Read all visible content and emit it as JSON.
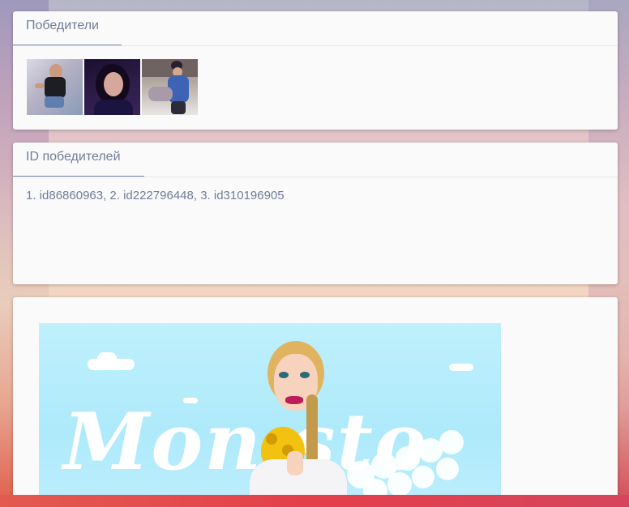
{
  "winners_card": {
    "title": "Победители",
    "avatars": [
      {
        "name": "winner-1"
      },
      {
        "name": "winner-2"
      },
      {
        "name": "winner-3"
      }
    ]
  },
  "ids_card": {
    "title": "ID победителей",
    "text": "1. id86860963, 2. id222796448, 3. id310196905"
  },
  "banner_card": {
    "brand_text": "Mon  sto"
  },
  "colors": {
    "card_bg": "#fafafa",
    "title_color": "#6f7d99",
    "banner_sky": "#aeeafb"
  }
}
